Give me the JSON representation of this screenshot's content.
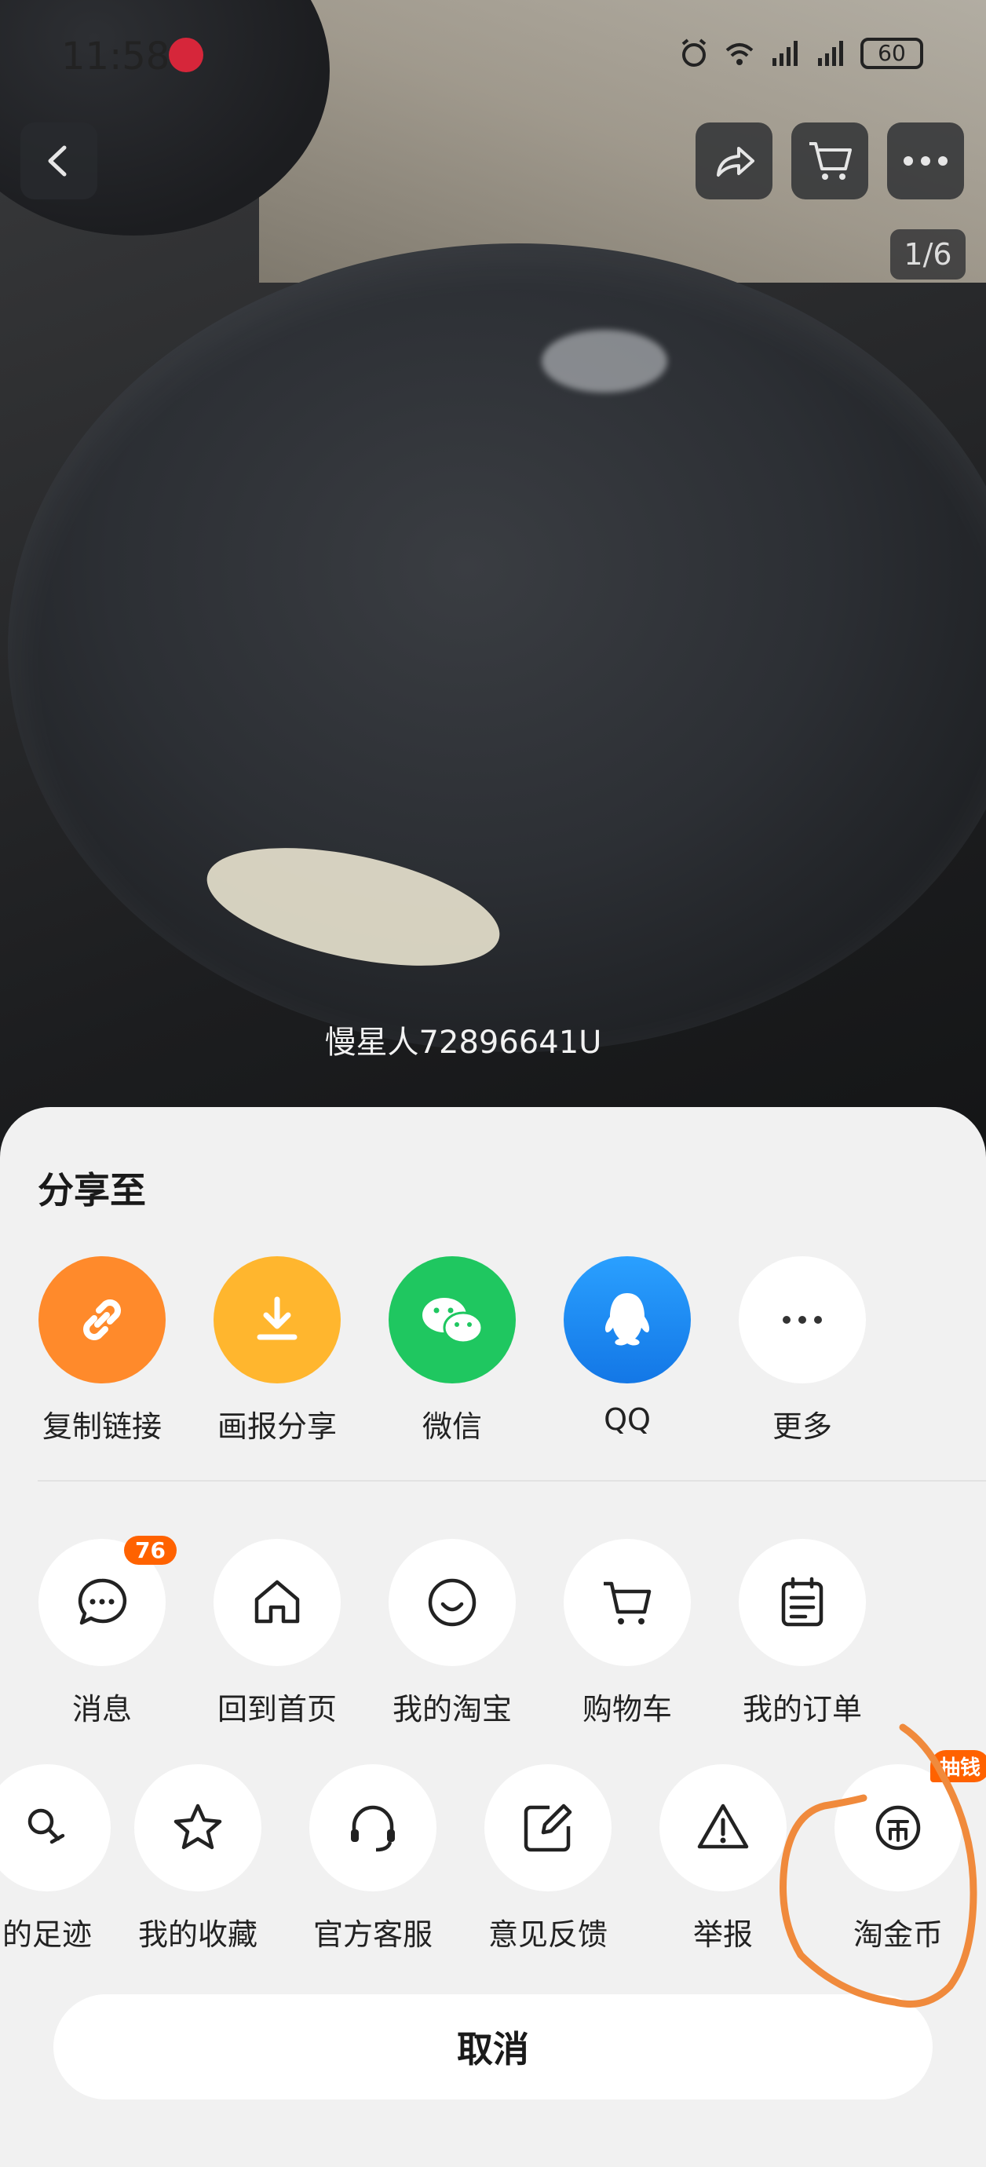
{
  "status": {
    "time": "11:58",
    "battery": "60"
  },
  "top": {
    "counter": "1/6"
  },
  "watermark": "慢星人72896641U",
  "share": {
    "title": "分享至",
    "targets": [
      {
        "label": "复制链接",
        "icon": "link-icon",
        "color": "#ff8a2b"
      },
      {
        "label": "画报分享",
        "icon": "download-icon",
        "color": "#ffb62e"
      },
      {
        "label": "微信",
        "icon": "wechat-icon",
        "color": "#1fc760"
      },
      {
        "label": "QQ",
        "icon": "qq-icon",
        "color": "#1f8bf5"
      },
      {
        "label": "更多",
        "icon": "more-icon",
        "color": "#ffffff"
      }
    ]
  },
  "actions_row1": [
    {
      "label": "消息",
      "icon": "message-icon",
      "badge": "76"
    },
    {
      "label": "回到首页",
      "icon": "home-icon"
    },
    {
      "label": "我的淘宝",
      "icon": "smile-icon"
    },
    {
      "label": "购物车",
      "icon": "cart-icon"
    },
    {
      "label": "我的订单",
      "icon": "order-icon"
    }
  ],
  "actions_row2": [
    {
      "label": "的足迹",
      "icon": "footprint-icon"
    },
    {
      "label": "我的收藏",
      "icon": "star-icon"
    },
    {
      "label": "官方客服",
      "icon": "headset-icon"
    },
    {
      "label": "意见反馈",
      "icon": "edit-icon"
    },
    {
      "label": "举报",
      "icon": "warning-icon"
    },
    {
      "label": "淘金币",
      "icon": "coin-icon",
      "badge": "抽钱"
    }
  ],
  "cancel_label": "取消",
  "colors": {
    "accent": "#ff6200",
    "annotation": "#f08a3c"
  }
}
